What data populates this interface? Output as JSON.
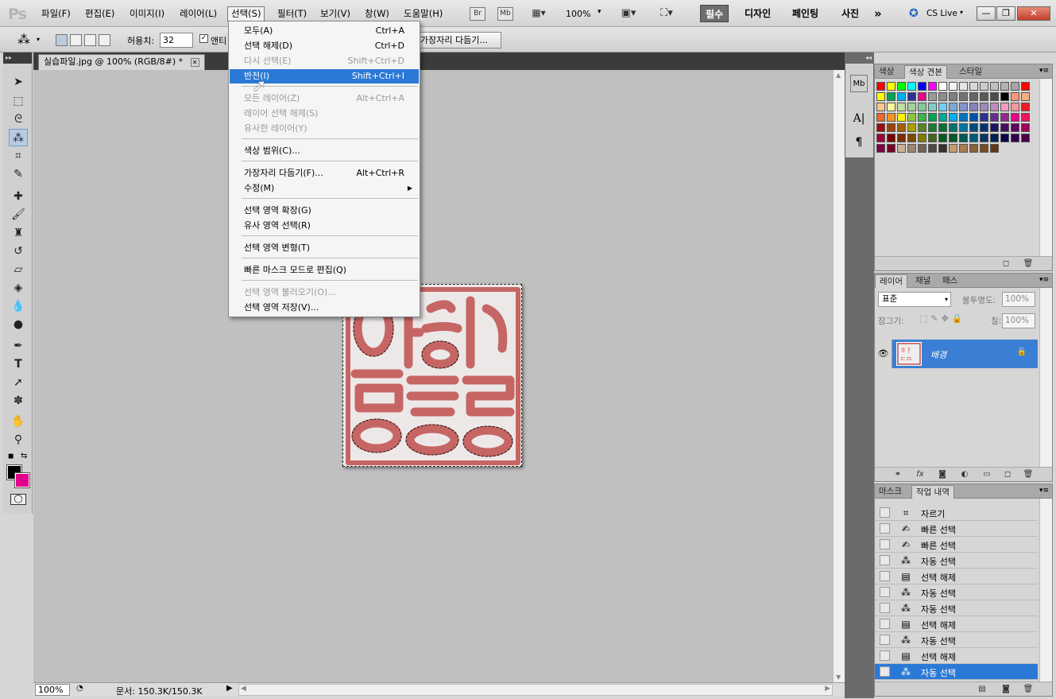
{
  "app": {
    "logo": "Ps"
  },
  "menubar": {
    "items": [
      "파일(F)",
      "편집(E)",
      "이미지(I)",
      "레이어(L)",
      "선택(S)",
      "필터(T)",
      "보기(V)",
      "창(W)",
      "도움말(H)"
    ],
    "bridge_label": "Br",
    "minibridge_label": "Mb",
    "zoom_value": "100%",
    "workspaces": [
      "필수",
      "디자인",
      "페인팅",
      "사진"
    ],
    "more_label": "»",
    "cs_live_label": "CS Live"
  },
  "options_bar": {
    "tolerance_label": "허용치:",
    "tolerance_value": "32",
    "antialias_label": "앤티",
    "refine_edge_label": "가장자리 다듬기..."
  },
  "document": {
    "tab_title": "실습파일.jpg @ 100% (RGB/8#) *",
    "status_zoom": "100%",
    "status_info": "문서: 150.3K/150.3K"
  },
  "select_menu": {
    "items": [
      {
        "label": "모두(A)",
        "shortcut": "Ctrl+A",
        "disabled": false
      },
      {
        "label": "선택 해제(D)",
        "shortcut": "Ctrl+D",
        "disabled": false
      },
      {
        "label": "다시 선택(E)",
        "shortcut": "Shift+Ctrl+D",
        "disabled": true
      },
      {
        "label": "반전(I)",
        "shortcut": "Shift+Ctrl+I",
        "disabled": false,
        "highlighted": true
      },
      {
        "label": "모든 레이어(Z)",
        "shortcut": "Alt+Ctrl+A",
        "disabled": true
      },
      {
        "label": "레이어 선택 해제(S)",
        "shortcut": "",
        "disabled": true
      },
      {
        "label": "유사한 레이어(Y)",
        "shortcut": "",
        "disabled": true
      },
      {
        "label": "색상 범위(C)...",
        "shortcut": "",
        "disabled": false
      },
      {
        "label": "가장자리 다듬기(F)...",
        "shortcut": "Alt+Ctrl+R",
        "disabled": false
      },
      {
        "label": "수정(M)",
        "shortcut": "",
        "disabled": false,
        "submenu": true
      },
      {
        "label": "선택 영역 확장(G)",
        "shortcut": "",
        "disabled": false
      },
      {
        "label": "유사 영역 선택(R)",
        "shortcut": "",
        "disabled": false
      },
      {
        "label": "선택 영역 변형(T)",
        "shortcut": "",
        "disabled": false
      },
      {
        "label": "빠른 마스크 모드로 편집(Q)",
        "shortcut": "",
        "disabled": false
      },
      {
        "label": "선택 영역 불러오기(O)...",
        "shortcut": "",
        "disabled": true
      },
      {
        "label": "선택 영역 저장(V)...",
        "shortcut": "",
        "disabled": false
      }
    ]
  },
  "swatches_panel": {
    "tabs": [
      "색상",
      "색상 견본",
      "스타일"
    ],
    "colors": [
      "#ff0000",
      "#ffff00",
      "#00ff00",
      "#00ffff",
      "#0000ff",
      "#ff00ff",
      "#ffffff",
      "#f2f2f2",
      "#e5e5e5",
      "#d8d8d8",
      "#cccccc",
      "#bfbfbf",
      "#b2b2b2",
      "#a5a5a5",
      "#ff0000",
      "#ffff00",
      "#00a651",
      "#00aeef",
      "#2e3192",
      "#ec008c",
      "#999999",
      "#8c8c8c",
      "#808080",
      "#737373",
      "#666666",
      "#595959",
      "#4c4c4c",
      "#000000",
      "#f7977a",
      "#f9ad81",
      "#fdc68a",
      "#fff79a",
      "#c4df9b",
      "#a2d39c",
      "#82ca9d",
      "#7bcdc8",
      "#6ecff6",
      "#7ea7d8",
      "#8493ca",
      "#8882be",
      "#a187be",
      "#bc8dbf",
      "#f49ac2",
      "#f6989d",
      "#ed1c24",
      "#f26522",
      "#f7941d",
      "#fff200",
      "#8dc73f",
      "#39b54a",
      "#00a651",
      "#00a99d",
      "#00aeef",
      "#0072bc",
      "#0054a6",
      "#2e3192",
      "#662d91",
      "#92278f",
      "#ec008c",
      "#ed145b",
      "#9e0b0f",
      "#a0410d",
      "#a36209",
      "#aba000",
      "#598527",
      "#197b30",
      "#007236",
      "#00746b",
      "#0076a3",
      "#004b80",
      "#003471",
      "#1b1464",
      "#440e62",
      "#630460",
      "#9e005d",
      "#9e0039",
      "#790000",
      "#7b2e00",
      "#7d4900",
      "#827b00",
      "#406618",
      "#005e20",
      "#005826",
      "#005952",
      "#005b7f",
      "#003663",
      "#002157",
      "#0d004c",
      "#32004b",
      "#4b0049",
      "#7b0046",
      "#7a0026",
      "#c7b299",
      "#998675",
      "#736357",
      "#534741",
      "#37302d",
      "#c69c6d",
      "#a67c52",
      "#8c6239",
      "#754c24",
      "#603913"
    ],
    "colors_per_row": 15
  },
  "layers_panel": {
    "tabs": [
      "레이어",
      "채널",
      "패스"
    ],
    "blend_mode": "표준",
    "opacity_label": "불투명도:",
    "opacity_value": "100%",
    "lock_label": "잠그기:",
    "fill_label": "칠:",
    "fill_value": "100%",
    "layers": [
      {
        "name": "배경",
        "locked": true
      }
    ]
  },
  "history_panel": {
    "tabs": [
      "마스크",
      "작업 내역"
    ],
    "items": [
      {
        "label": "자르기",
        "icon": "crop-icon"
      },
      {
        "label": "빠른 선택",
        "icon": "quick-selection-icon"
      },
      {
        "label": "빠른 선택",
        "icon": "quick-selection-icon"
      },
      {
        "label": "자동 선택",
        "icon": "magic-wand-icon"
      },
      {
        "label": "선택 해제",
        "icon": "document-icon"
      },
      {
        "label": "자동 선택",
        "icon": "magic-wand-icon"
      },
      {
        "label": "자동 선택",
        "icon": "magic-wand-icon"
      },
      {
        "label": "선택 해제",
        "icon": "document-icon"
      },
      {
        "label": "자동 선택",
        "icon": "magic-wand-icon"
      },
      {
        "label": "선택 해제",
        "icon": "document-icon"
      },
      {
        "label": "자동 선택",
        "icon": "magic-wand-icon",
        "selected": true
      }
    ]
  },
  "colors": {
    "foreground": "#000000",
    "background": "#e0008c",
    "selection_blue": "#2b79d6",
    "stamp_red": "#c0504d"
  }
}
